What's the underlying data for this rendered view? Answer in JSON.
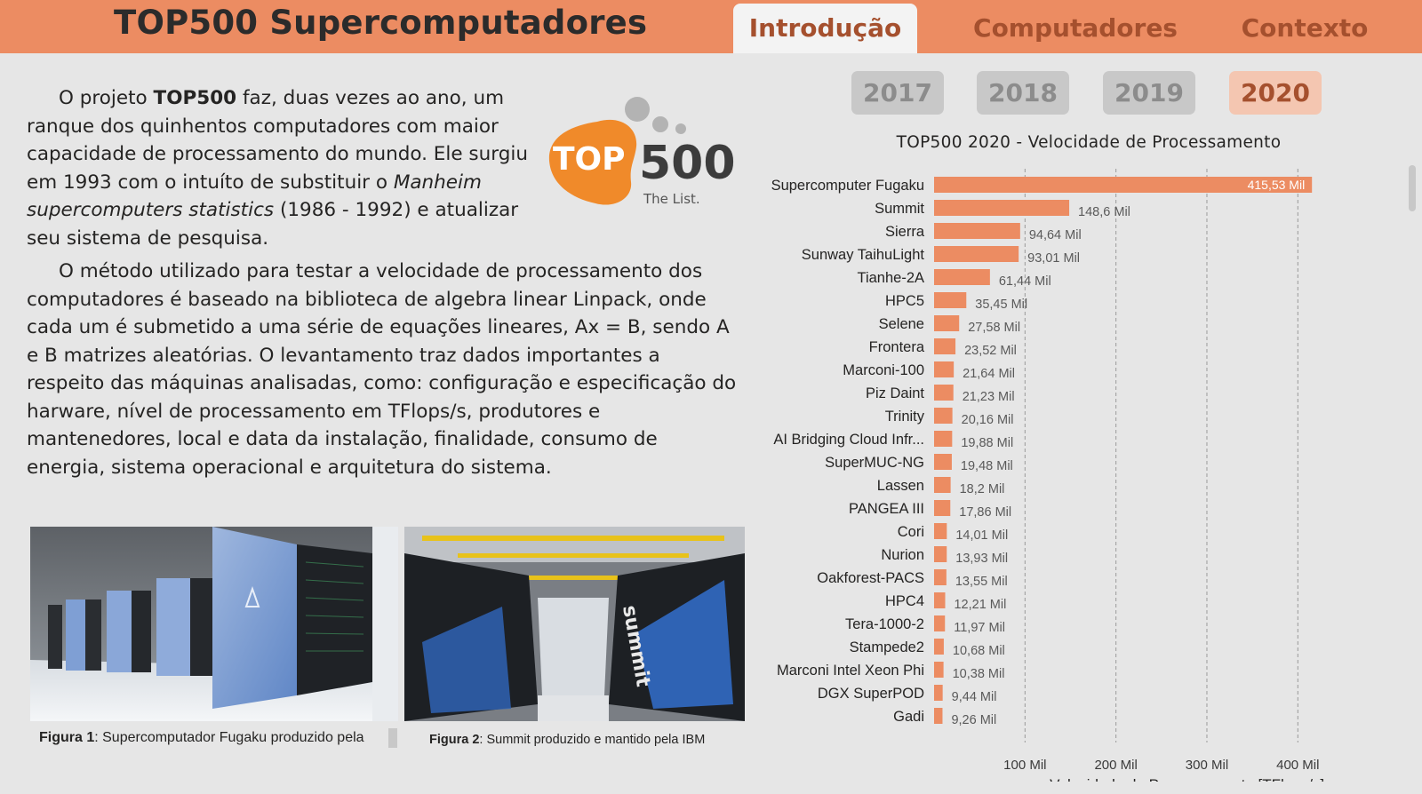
{
  "header": {
    "title": "TOP500 Supercomputadores",
    "tabs": [
      {
        "label": "Introdução",
        "active": true
      },
      {
        "label": "Computadores",
        "active": false
      },
      {
        "label": "Contexto",
        "active": false
      }
    ]
  },
  "intro": {
    "p1_a": "O projeto ",
    "p1_b": "TOP500",
    "p1_c": " faz, duas vezes ao ano, um ranque dos quinhentos computadores com maior capacidade de processamento do mundo.  Ele surgiu em 1993 com o intuíto de substituir o ",
    "p1_d": "Manheim supercomputers statistics",
    "p1_e": " (1986 - 1992) e atualizar seu sistema de pesquisa.",
    "p2": "O método utilizado para testar a velocidade de processamento dos computadores é baseado na biblioteca de algebra linear Linpack, onde cada um é submetido a uma série de equações lineares, Ax = B, sendo A e B matrizes aleatórias. O levantamento traz dados importantes a respeito das máquinas analisadas, como: configuração e especificação do harware,  nível de processamento em TFlops/s, produtores e mantenedores, local e data da instalação, finalidade, consumo de energia, sistema operacional e arquitetura do sistema."
  },
  "logo": {
    "word1": "TOP",
    "word2": "500",
    "tagline": "The List."
  },
  "figures": [
    {
      "label": "Figura 1",
      "text": ": Supercomputador Fugaku produzido pela"
    },
    {
      "label": "Figura 2",
      "text": ": Summit produzido e mantido pela IBM"
    }
  ],
  "year_buttons": [
    {
      "label": "2017",
      "active": false
    },
    {
      "label": "2018",
      "active": false
    },
    {
      "label": "2019",
      "active": false
    },
    {
      "label": "2020",
      "active": true
    }
  ],
  "colors": {
    "accent": "#ec8c62",
    "bar": "#ec8c62",
    "header_text": "#a5502e"
  },
  "chart_data": {
    "type": "bar",
    "orientation": "horizontal",
    "title": "TOP500 2020 - Velocidade de Processamento",
    "xlabel": "Velocidade de Processamento [TFlops/s]",
    "xlim": [
      0,
      430000
    ],
    "x_ticks": [
      100000,
      200000,
      300000,
      400000
    ],
    "x_tick_labels": [
      "100 Mil",
      "200 Mil",
      "300 Mil",
      "400 Mil"
    ],
    "grid": "vertical-dashed",
    "categories": [
      "Supercomputer Fugaku",
      "Summit",
      "Sierra",
      "Sunway TaihuLight",
      "Tianhe-2A",
      "HPC5",
      "Selene",
      "Frontera",
      "Marconi-100",
      "Piz Daint",
      "Trinity",
      "AI Bridging Cloud Infr...",
      "SuperMUC-NG",
      "Lassen",
      "PANGEA III",
      "Cori",
      "Nurion",
      "Oakforest-PACS",
      "HPC4",
      "Tera-1000-2",
      "Stampede2",
      "Marconi Intel Xeon Phi",
      "DGX SuperPOD",
      "Gadi"
    ],
    "values": [
      415530,
      148600,
      94640,
      93010,
      61440,
      35450,
      27580,
      23520,
      21640,
      21230,
      20160,
      19880,
      19480,
      18200,
      17860,
      14010,
      13930,
      13550,
      12210,
      11970,
      10680,
      10380,
      9440,
      9260
    ],
    "data_labels": [
      "415,53 Mil",
      "148,6 Mil",
      "94,64 Mil",
      "93,01 Mil",
      "61,44 Mil",
      "35,45 Mil",
      "27,58 Mil",
      "23,52 Mil",
      "21,64 Mil",
      "21,23 Mil",
      "20,16 Mil",
      "19,88 Mil",
      "19,48 Mil",
      "18,2 Mil",
      "17,86 Mil",
      "14,01 Mil",
      "13,93 Mil",
      "13,55 Mil",
      "12,21 Mil",
      "11,97 Mil",
      "10,68 Mil",
      "10,38 Mil",
      "9,44 Mil",
      "9,26 Mil"
    ]
  }
}
